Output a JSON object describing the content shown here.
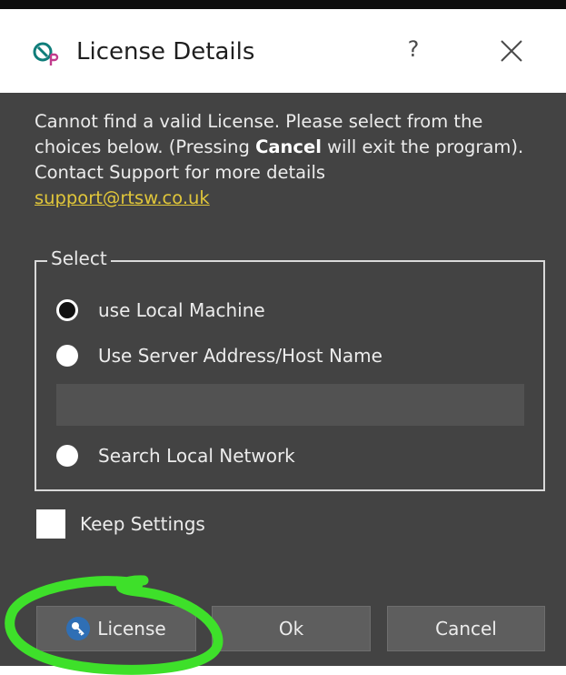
{
  "dialog": {
    "title": "License Details",
    "help_label": "?",
    "close_icon": "close-icon",
    "app_icon": "app-logo-icon"
  },
  "message": {
    "line_part1": "Cannot find a valid License. Please select from the choices below. (Pressing ",
    "bold_word": "Cancel",
    "line_part2": " will exit the program). Contact Support for more details",
    "support_email": "support@rtsw.co.uk"
  },
  "select_group": {
    "legend": "Select",
    "options": [
      {
        "label": "use Local Machine",
        "checked": true
      },
      {
        "label": "Use Server Address/Host Name",
        "checked": false
      },
      {
        "label": "Search Local Network",
        "checked": false
      }
    ],
    "server_input": {
      "value": "",
      "placeholder": ""
    }
  },
  "keep_settings": {
    "label": "Keep Settings",
    "checked": false
  },
  "buttons": {
    "license": "License",
    "ok": "Ok",
    "cancel": "Cancel",
    "license_icon": "key-icon"
  },
  "colors": {
    "dialog_bg": "#434343",
    "link": "#e0c63a",
    "highlight_stroke": "#3ee02a",
    "button_bg": "#5e5e5e"
  }
}
